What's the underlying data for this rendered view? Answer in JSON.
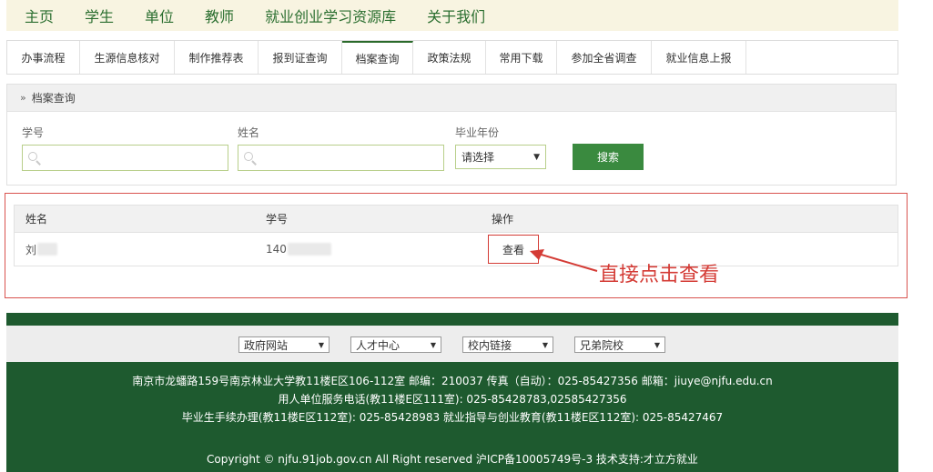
{
  "nav": {
    "items": [
      "主页",
      "学生",
      "单位",
      "教师",
      "就业创业学习资源库",
      "关于我们"
    ]
  },
  "tabs": [
    "办事流程",
    "生源信息核对",
    "制作推荐表",
    "报到证查询",
    "档案查询",
    "政策法规",
    "常用下载",
    "参加全省调查",
    "就业信息上报"
  ],
  "active_tab": "档案查询",
  "panel": {
    "title": "档案查询",
    "student_id_label": "学号",
    "name_label": "姓名",
    "grad_year_label": "毕业年份",
    "grad_year_value": "请选择",
    "search_button": "搜索"
  },
  "results": {
    "headers": {
      "name": "姓名",
      "id": "学号",
      "action": "操作"
    },
    "row": {
      "name": "刘",
      "id": "140",
      "action": "查看"
    }
  },
  "annotation": "直接点击查看",
  "footer": {
    "selects": [
      "政府网站",
      "人才中心",
      "校内链接",
      "兄弟院校"
    ],
    "lines": [
      "南京市龙蟠路159号南京林业大学教11楼E区106-112室  邮编：210037  传真（自动）：025-85427356   邮箱：jiuye@njfu.edu.cn",
      "用人单位服务电话(教11楼E区111室):  025-85428783,02585427356",
      "毕业生手续办理(教11楼E区112室):   025-85428983    就业指导与创业教育(教11楼E区112室): 025-85427467",
      "Copyright © njfu.91job.gov.cn All Right reserved 沪ICP备10005749号-3 技术支持:才立方就业"
    ]
  },
  "colors": {
    "nav_bg": "#f8f4e1",
    "nav_text": "#2a6e2f",
    "footer_green": "#1e5a2f",
    "accent_red": "#d43b35",
    "search_btn": "#3a8a3f"
  }
}
